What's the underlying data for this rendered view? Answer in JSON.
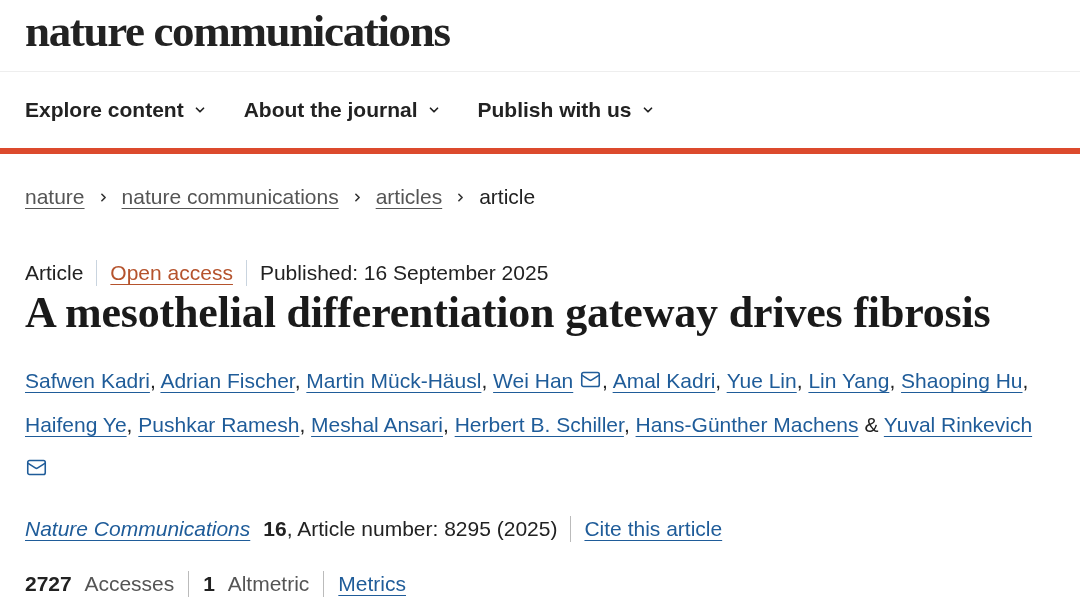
{
  "header": {
    "logo": "nature communications"
  },
  "nav": [
    {
      "label": "Explore content"
    },
    {
      "label": "About the journal"
    },
    {
      "label": "Publish with us"
    }
  ],
  "breadcrumb": [
    {
      "label": "nature",
      "kind": "link"
    },
    {
      "label": "nature communications",
      "kind": "link"
    },
    {
      "label": "articles",
      "kind": "link"
    },
    {
      "label": "article",
      "kind": "current"
    }
  ],
  "article": {
    "type": "Article",
    "access": "Open access",
    "published": "Published: 16 September 2025",
    "title": "A mesothelial differentiation gateway drives fibrosis",
    "authors": [
      {
        "name": "Safwen Kadri",
        "corresponding": false,
        "separator": ","
      },
      {
        "name": "Adrian Fischer",
        "corresponding": false,
        "separator": ","
      },
      {
        "name": "Martin Mück-Häusl",
        "corresponding": false,
        "separator": ","
      },
      {
        "name": "Wei Han",
        "corresponding": true,
        "separator": ","
      },
      {
        "name": "Amal Kadri",
        "corresponding": false,
        "separator": ","
      },
      {
        "name": "Yue Lin",
        "corresponding": false,
        "separator": ","
      },
      {
        "name": "Lin Yang",
        "corresponding": false,
        "separator": ","
      },
      {
        "name": "Shaoping Hu",
        "corresponding": false,
        "separator": ","
      },
      {
        "name": "Haifeng Ye",
        "corresponding": false,
        "separator": ","
      },
      {
        "name": "Pushkar Ramesh",
        "corresponding": false,
        "separator": ","
      },
      {
        "name": "Meshal Ansari",
        "corresponding": false,
        "separator": ","
      },
      {
        "name": "Herbert B. Schiller",
        "corresponding": false,
        "separator": ","
      },
      {
        "name": "Hans-Günther Machens",
        "corresponding": false
      },
      {
        "name": "Yuval Rinkevich",
        "corresponding": true,
        "conjunction": "&"
      }
    ],
    "citation": {
      "journal": "Nature Communications",
      "details": "**16**, Article number: 8295 (2025)",
      "cite_link": "Cite this article"
    },
    "metrics": [
      {
        "text": "**2727** Accesses"
      },
      {
        "text": "**1** Altmetric"
      }
    ],
    "metrics_link": "Metrics"
  }
}
